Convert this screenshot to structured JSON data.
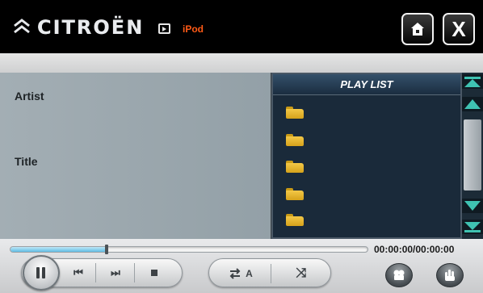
{
  "header": {
    "brand": "CITROËN",
    "source_label": "iPod",
    "source_label_color": "#ff5a16",
    "source_icon": "media-source-icon",
    "home_icon": "home-icon",
    "close_label": "X"
  },
  "info": {
    "artist_label": "Artist",
    "title_label": "Title"
  },
  "playlist": {
    "header": "PLAY LIST",
    "items": [
      {
        "icon": "folder-icon"
      },
      {
        "icon": "folder-icon"
      },
      {
        "icon": "folder-icon"
      },
      {
        "icon": "folder-icon"
      },
      {
        "icon": "folder-icon"
      }
    ]
  },
  "scrollbar": {
    "icons": [
      "scroll-top-icon",
      "scroll-up-icon",
      "scroll-down-icon",
      "scroll-bottom-icon"
    ]
  },
  "playback": {
    "progress": 0.27,
    "time_readout": "00:00:00/00:00:00"
  },
  "transport": {
    "pause_icon": "pause-icon",
    "prev_label": "⏮",
    "next_label": "⏭",
    "stop_icon": "stop-icon",
    "repeat_label": "A",
    "shuffle_label": "⤨"
  },
  "colors": {
    "accent_teal": "#3fc2b2",
    "playlist_bg": "#1a2a3a",
    "info_bg": "#9aa6ad"
  }
}
